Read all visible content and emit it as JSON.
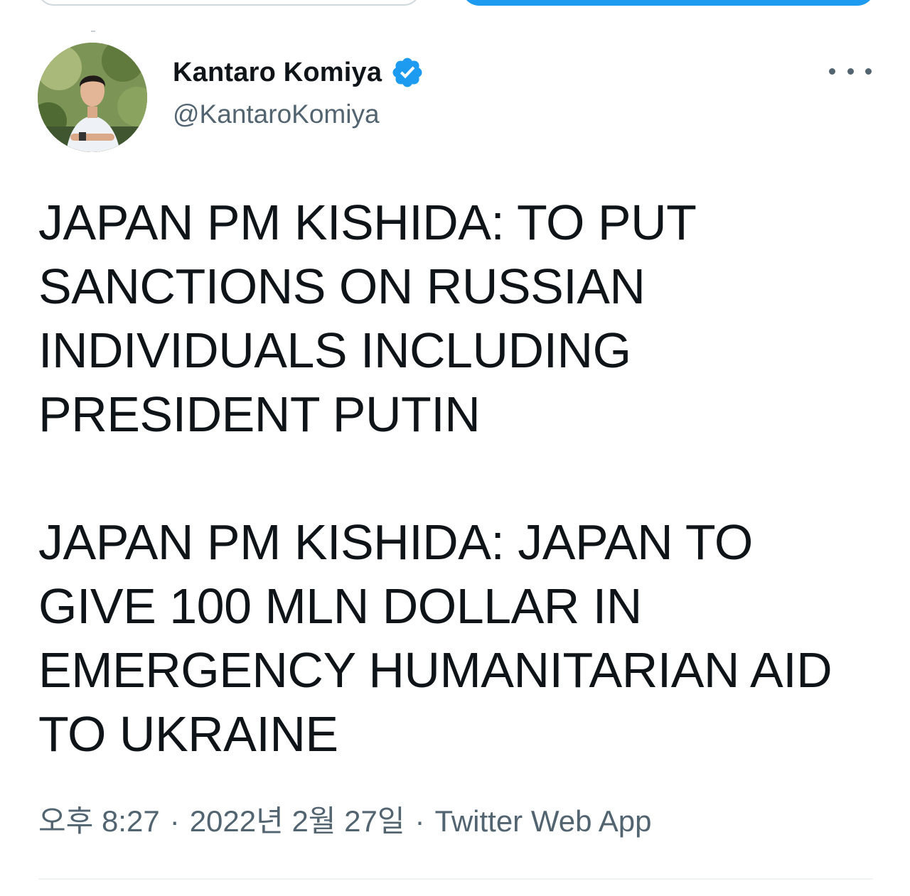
{
  "author": {
    "display_name": "Kantaro Komiya",
    "handle": "@KantaroKomiya",
    "verified": true
  },
  "icons": {
    "avatar": "profile-photo",
    "verified": "verified-badge-icon",
    "more": "more-options-icon"
  },
  "tweet": {
    "paragraphs": [
      "JAPAN PM KISHIDA: TO PUT\nSANCTIONS ON RUSSIAN\nINDIVIDUALS INCLUDING\nPRESIDENT PUTIN",
      "JAPAN PM KISHIDA: JAPAN TO\nGIVE 100 MLN DOLLAR IN\nEMERGENCY HUMANITARIAN AID\nTO UKRAINE"
    ]
  },
  "meta": {
    "time": "오후 8:27",
    "separator": "·",
    "date": "2022년 2월 27일",
    "source": "Twitter Web App"
  },
  "colors": {
    "accent": "#1d9bf0",
    "text_primary": "#0f1419",
    "text_secondary": "#536471",
    "divider": "#eff3f4"
  }
}
